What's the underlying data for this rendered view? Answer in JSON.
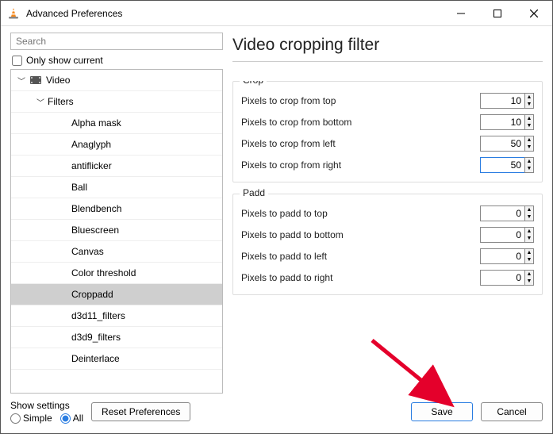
{
  "window": {
    "title": "Advanced Preferences"
  },
  "search": {
    "placeholder": "Search"
  },
  "only_show_current_label": "Only show current",
  "only_show_current_checked": false,
  "tree": {
    "items": [
      {
        "label": "Video",
        "level": 0,
        "expanded": true,
        "icon": "video",
        "selected": false
      },
      {
        "label": "Filters",
        "level": 1,
        "expanded": true,
        "icon": "",
        "selected": false
      },
      {
        "label": "Alpha mask",
        "level": 2,
        "selected": false
      },
      {
        "label": "Anaglyph",
        "level": 2,
        "selected": false
      },
      {
        "label": "antiflicker",
        "level": 2,
        "selected": false
      },
      {
        "label": "Ball",
        "level": 2,
        "selected": false
      },
      {
        "label": "Blendbench",
        "level": 2,
        "selected": false
      },
      {
        "label": "Bluescreen",
        "level": 2,
        "selected": false
      },
      {
        "label": "Canvas",
        "level": 2,
        "selected": false
      },
      {
        "label": "Color threshold",
        "level": 2,
        "selected": false
      },
      {
        "label": "Croppadd",
        "level": 2,
        "selected": true
      },
      {
        "label": "d3d11_filters",
        "level": 2,
        "selected": false
      },
      {
        "label": "d3d9_filters",
        "level": 2,
        "selected": false
      },
      {
        "label": "Deinterlace",
        "level": 2,
        "selected": false
      }
    ]
  },
  "page_heading": "Video cropping filter",
  "groups": [
    {
      "title": "Crop",
      "fields": [
        {
          "label": "Pixels to crop from top",
          "value": "10",
          "focused": false
        },
        {
          "label": "Pixels to crop from bottom",
          "value": "10",
          "focused": false
        },
        {
          "label": "Pixels to crop from left",
          "value": "50",
          "focused": false
        },
        {
          "label": "Pixels to crop from right",
          "value": "50",
          "focused": true
        }
      ]
    },
    {
      "title": "Padd",
      "fields": [
        {
          "label": "Pixels to padd to top",
          "value": "0",
          "focused": false
        },
        {
          "label": "Pixels to padd to bottom",
          "value": "0",
          "focused": false
        },
        {
          "label": "Pixels to padd to left",
          "value": "0",
          "focused": false
        },
        {
          "label": "Pixels to padd to right",
          "value": "0",
          "focused": false
        }
      ]
    }
  ],
  "bottom": {
    "show_settings_label": "Show settings",
    "radio_simple": "Simple",
    "radio_all": "All",
    "radio_selected": "all",
    "reset_label": "Reset Preferences",
    "save_label": "Save",
    "cancel_label": "Cancel"
  },
  "colors": {
    "accent": "#2a7de1",
    "arrow": "#e4002b"
  }
}
